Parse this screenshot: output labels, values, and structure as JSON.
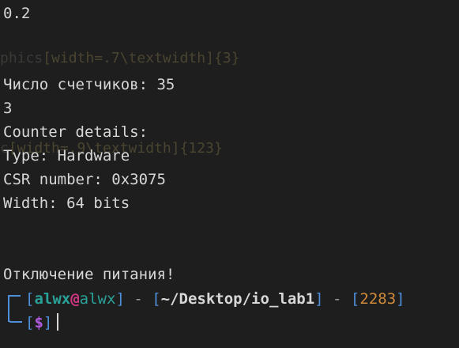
{
  "output": {
    "line_1": "0.2",
    "line_2": "Число счетчиков: 35",
    "line_3": "3",
    "line_4": "Counter details:",
    "line_5": "Type: Hardware",
    "line_6": "CSR number: 0x3075",
    "line_7": "Width: 64 bits",
    "line_8": "Отключение питания!"
  },
  "ghost": {
    "text_1_a": "phics",
    "text_1_b": "[width=.7\\textwidth]",
    "text_1_c": "{3}",
    "text_2_a": "c",
    "text_2_b": "[width=.9\\textwidth]",
    "text_2_c": "{123}"
  },
  "prompt": {
    "user": "alwx",
    "at": "@",
    "host": "alwx",
    "separator": " - ",
    "path": "~/Desktop/io_lab1",
    "number": "2283",
    "symbol": "$"
  },
  "colors": {
    "background": "#1e1e1e",
    "text": "#d7d7d7",
    "bracket": "#4f8fd9",
    "user": "#2aa198",
    "at": "#d33682",
    "number": "#d08a3a",
    "dollar": "#b05ce0"
  }
}
